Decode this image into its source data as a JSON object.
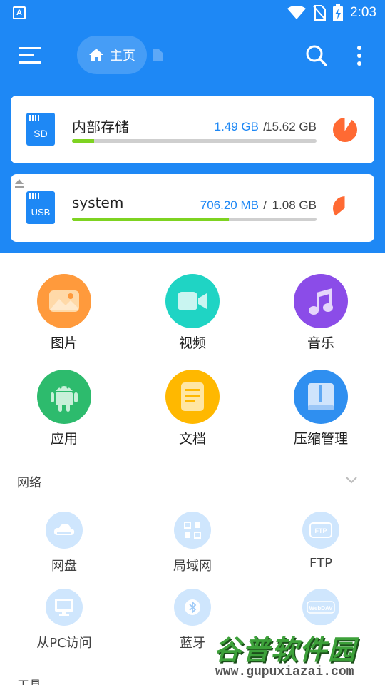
{
  "status_bar": {
    "time": "2:03",
    "left_icon": "A",
    "icons": [
      "wifi-icon",
      "no-sim-icon",
      "battery-charging-icon"
    ]
  },
  "app_bar": {
    "breadcrumb_home": "主页"
  },
  "storage": [
    {
      "name": "内部存储",
      "badge": "SD",
      "used": "1.49 GB",
      "separator": "/",
      "total": "15.62 GB",
      "usage_fraction": 0.09
    },
    {
      "name": "system",
      "badge": "USB",
      "used": "706.20 MB",
      "separator": "/",
      "total": "1.08 GB",
      "usage_fraction": 0.64
    }
  ],
  "categories": [
    {
      "label": "图片",
      "icon": "image-icon",
      "color": "#ff9a3c"
    },
    {
      "label": "视频",
      "icon": "video-icon",
      "color": "#1fd4c4"
    },
    {
      "label": "音乐",
      "icon": "music-icon",
      "color": "#8b4ce8"
    },
    {
      "label": "应用",
      "icon": "android-icon",
      "color": "#2dbb6d"
    },
    {
      "label": "文档",
      "icon": "document-icon",
      "color": "#ffb800"
    },
    {
      "label": "压缩管理",
      "icon": "archive-icon",
      "color": "#2f8ff0"
    }
  ],
  "network_section": {
    "title": "网络",
    "items": [
      {
        "label": "网盘",
        "icon": "cloud-drive-icon"
      },
      {
        "label": "局域网",
        "icon": "lan-icon"
      },
      {
        "label": "FTP",
        "icon": "ftp-icon",
        "badge": "FTP"
      },
      {
        "label": "从PC访问",
        "icon": "pc-access-icon"
      },
      {
        "label": "蓝牙",
        "icon": "bluetooth-icon"
      },
      {
        "label": "",
        "icon": "webdav-icon",
        "badge": "WebDAV"
      }
    ]
  },
  "tools_section": {
    "title": "工具"
  },
  "watermark": {
    "title": "谷普软件园",
    "url": "www.gupuxiazai.com"
  },
  "colors": {
    "primary": "#1e88f5",
    "progress": "#7ed321",
    "pie": "#ff6a33"
  }
}
